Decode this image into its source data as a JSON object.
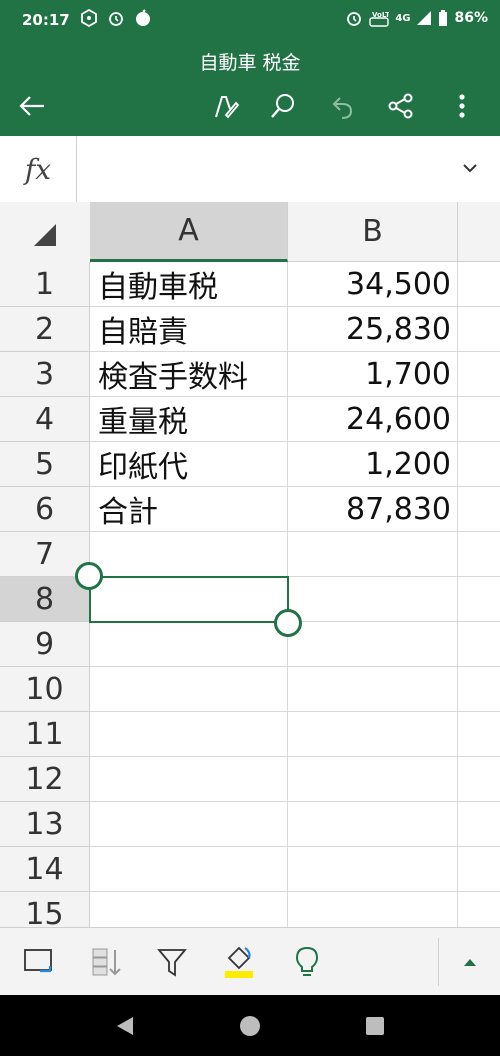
{
  "status_bar": {
    "time": "20:17",
    "battery": "86%",
    "network": "4G"
  },
  "app_bar": {
    "title": "自動車 税金"
  },
  "formula_bar": {
    "fx_label": "fx",
    "value": ""
  },
  "columns": [
    "A",
    "B"
  ],
  "rows": [
    "1",
    "2",
    "3",
    "4",
    "5",
    "6",
    "7",
    "8",
    "9",
    "10",
    "11",
    "12",
    "13",
    "14",
    "15"
  ],
  "cells": [
    {
      "a": "自動車税",
      "b": "34,500"
    },
    {
      "a": "自賠責",
      "b": "25,830"
    },
    {
      "a": "検査手数料",
      "b": "1,700"
    },
    {
      "a": "重量税",
      "b": "24,600"
    },
    {
      "a": "印紙代",
      "b": "1,200"
    },
    {
      "a": "合計",
      "b": "87,830"
    }
  ],
  "selection": {
    "cell": "A8"
  },
  "colors": {
    "brand_green": "#217346",
    "header_bg": "#f3f3f3",
    "selected_header_bg": "#d4d4d4",
    "fill_color_accent": "#ffeb00",
    "nav_bar": "#000000"
  },
  "icons": {
    "back": "arrow-left-icon",
    "draw": "pen-icon",
    "search": "search-icon",
    "undo": "undo-icon",
    "share": "share-icon",
    "more": "more-vertical-icon",
    "expand": "chevron-down-icon"
  }
}
